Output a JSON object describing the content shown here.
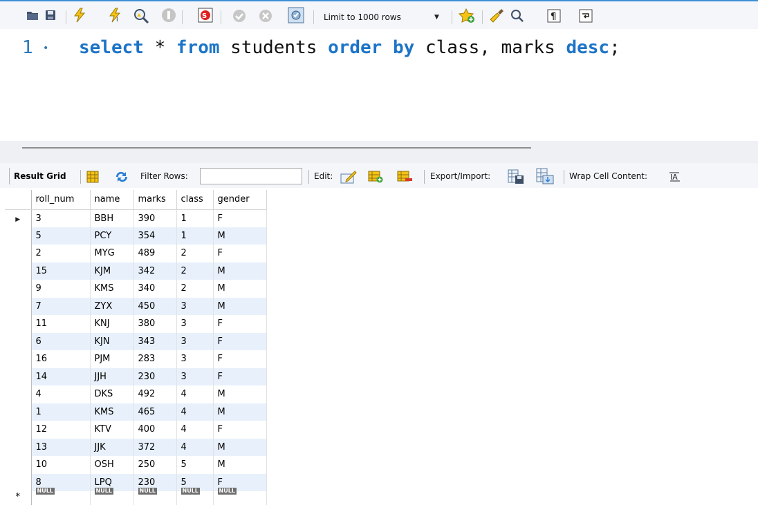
{
  "editor_toolbar": {
    "buttons": [
      {
        "name": "open-sql-file-icon"
      },
      {
        "name": "save-script-icon"
      },
      {
        "name": "execute-all-icon"
      },
      {
        "name": "execute-current-statement-icon"
      },
      {
        "name": "explain-query-icon"
      },
      {
        "name": "stop-execution-icon"
      },
      {
        "name": "toggle-stop-on-error-icon"
      },
      {
        "name": "commit-icon"
      },
      {
        "name": "rollback-icon"
      },
      {
        "name": "toggle-autocommit-icon"
      },
      {
        "name": "add-snippet-icon"
      },
      {
        "name": "beautify-icon"
      },
      {
        "name": "find-replace-icon"
      },
      {
        "name": "invisible-characters-icon"
      },
      {
        "name": "wrap-lines-icon"
      }
    ],
    "limit_select": {
      "value": "Limit to 1000 rows"
    }
  },
  "editor": {
    "line_number": "1",
    "line_marker": "•",
    "sql_tokens": [
      {
        "text": "select",
        "type": "kw"
      },
      {
        "text": " * ",
        "type": "plain"
      },
      {
        "text": "from",
        "type": "kw"
      },
      {
        "text": " students ",
        "type": "plain"
      },
      {
        "text": "order",
        "type": "kw"
      },
      {
        "text": " ",
        "type": "plain"
      },
      {
        "text": "by",
        "type": "kw"
      },
      {
        "text": " class, marks ",
        "type": "plain"
      },
      {
        "text": "desc",
        "type": "kw"
      },
      {
        "text": ";",
        "type": "plain"
      }
    ]
  },
  "result_toolbar": {
    "tab_label": "Result Grid",
    "filter_label": "Filter Rows:",
    "filter_value": "",
    "edit_label": "Edit:",
    "export_label": "Export/Import:",
    "wrap_label": "Wrap Cell Content:"
  },
  "result_grid": {
    "columns": [
      "roll_num",
      "name",
      "marks",
      "class",
      "gender"
    ],
    "rows": [
      [
        "3",
        "BBH",
        "390",
        "1",
        "F"
      ],
      [
        "5",
        "PCY",
        "354",
        "1",
        "M"
      ],
      [
        "2",
        "MYG",
        "489",
        "2",
        "F"
      ],
      [
        "15",
        "KJM",
        "342",
        "2",
        "M"
      ],
      [
        "9",
        "KMS",
        "340",
        "2",
        "M"
      ],
      [
        "7",
        "ZYX",
        "450",
        "3",
        "M"
      ],
      [
        "11",
        "KNJ",
        "380",
        "3",
        "F"
      ],
      [
        "6",
        "KJN",
        "343",
        "3",
        "F"
      ],
      [
        "16",
        "PJM",
        "283",
        "3",
        "F"
      ],
      [
        "14",
        "JJH",
        "230",
        "3",
        "F"
      ],
      [
        "4",
        "DKS",
        "492",
        "4",
        "M"
      ],
      [
        "1",
        "KMS",
        "465",
        "4",
        "M"
      ],
      [
        "12",
        "KTV",
        "400",
        "4",
        "F"
      ],
      [
        "13",
        "JJK",
        "372",
        "4",
        "M"
      ],
      [
        "10",
        "OSH",
        "250",
        "5",
        "M"
      ],
      [
        "8",
        "LPQ",
        "230",
        "5",
        "F"
      ]
    ],
    "null_label": "NULL",
    "current_row_marker": "▶",
    "new_row_marker": "*"
  }
}
